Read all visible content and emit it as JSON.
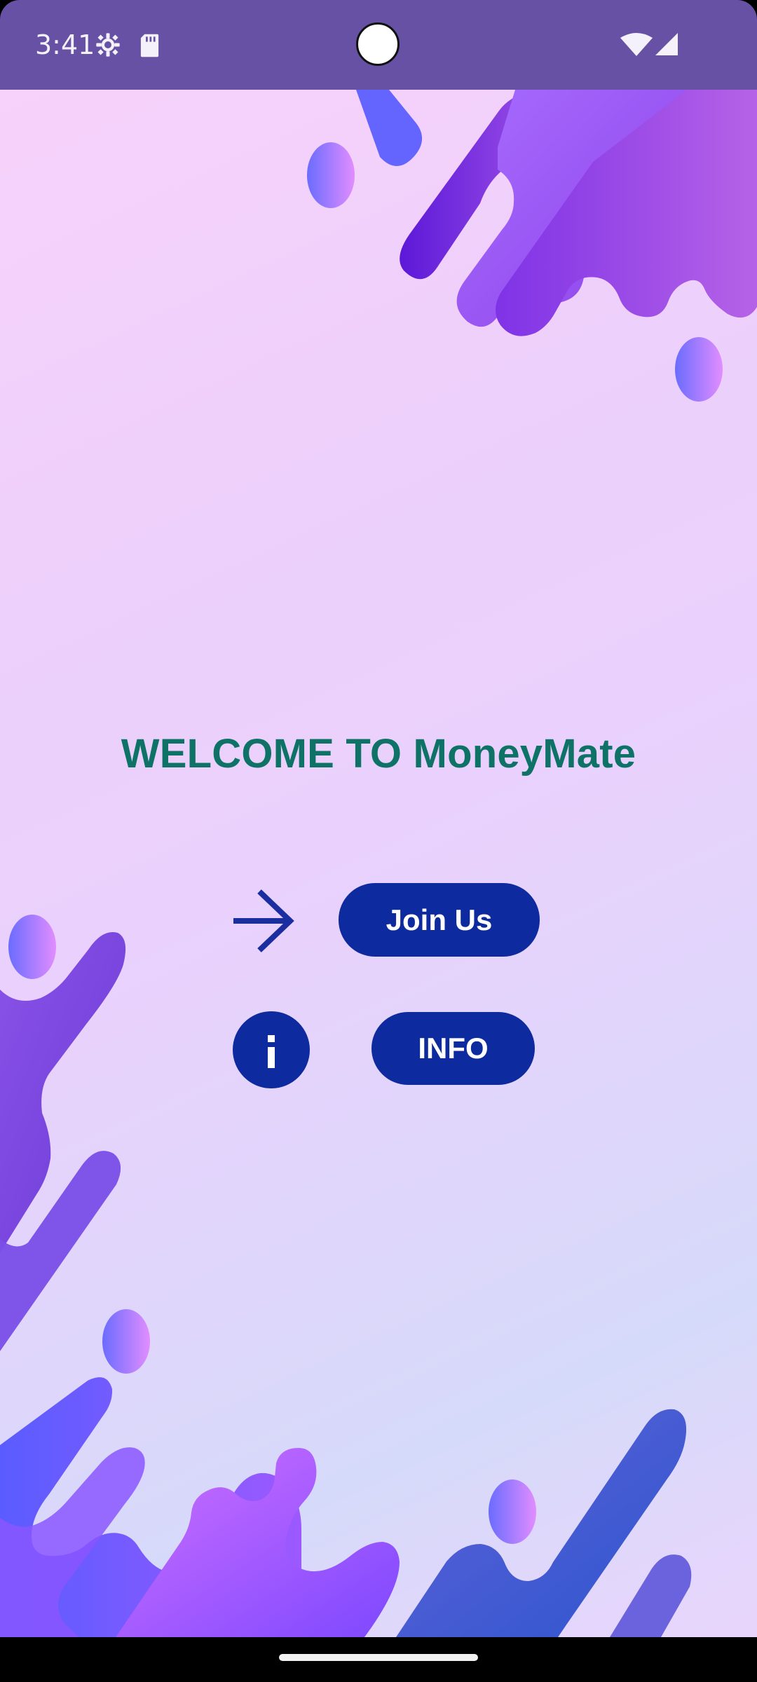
{
  "status_bar": {
    "time": "3:41",
    "icons": [
      "settings-gear-icon",
      "sd-card-icon",
      "wifi-icon",
      "cellular-signal-icon"
    ],
    "background": "#6651A5"
  },
  "main": {
    "welcome_text": "WELCOME TO MoneyMate",
    "title_color": "#0E7366",
    "join_button": "Join Us",
    "info_button": "INFO",
    "button_color": "#0D2B9E",
    "icons": [
      "arrow-right-icon",
      "info-icon"
    ]
  },
  "navigation": {
    "home_indicator": "home-indicator"
  }
}
